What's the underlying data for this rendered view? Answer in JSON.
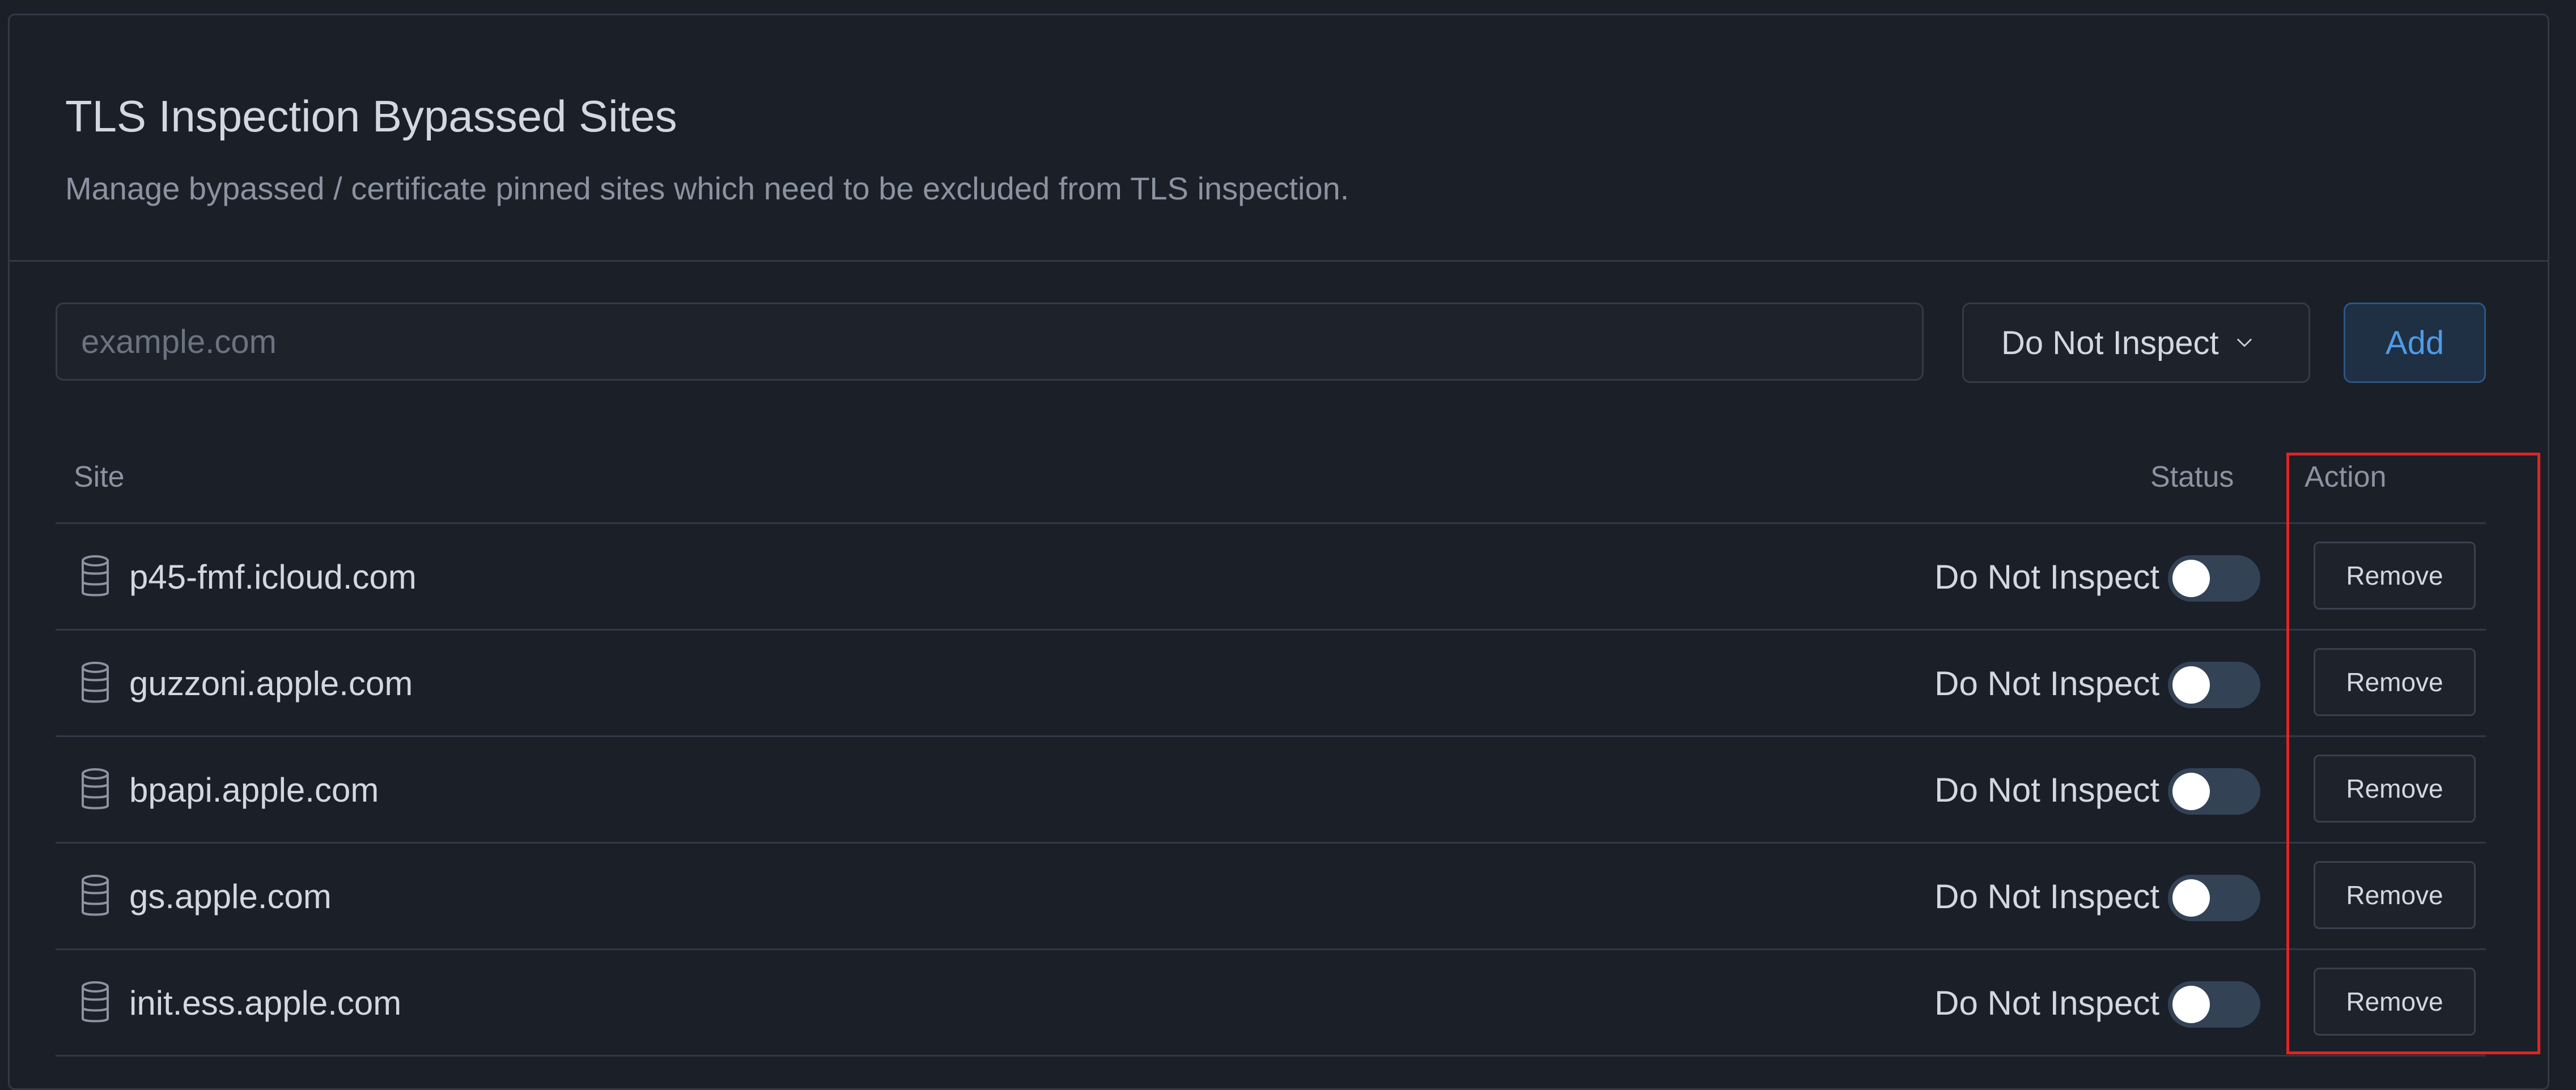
{
  "header": {
    "title": "TLS Inspection Bypassed Sites",
    "subtitle": "Manage bypassed / certificate pinned sites which need to be excluded from TLS inspection."
  },
  "form": {
    "site_placeholder": "example.com",
    "mode_value": "Do Not Inspect",
    "add_label": "Add"
  },
  "table": {
    "columns": [
      "Site",
      "Status",
      "Action"
    ],
    "rows": [
      {
        "site": "p45-fmf.icloud.com",
        "status": "Do Not Inspect",
        "enabled": false,
        "action": "Remove"
      },
      {
        "site": "guzzoni.apple.com",
        "status": "Do Not Inspect",
        "enabled": false,
        "action": "Remove"
      },
      {
        "site": "bpapi.apple.com",
        "status": "Do Not Inspect",
        "enabled": false,
        "action": "Remove"
      },
      {
        "site": "gs.apple.com",
        "status": "Do Not Inspect",
        "enabled": false,
        "action": "Remove"
      },
      {
        "site": "init.ess.apple.com",
        "status": "Do Not Inspect",
        "enabled": false,
        "action": "Remove"
      }
    ]
  },
  "icons": {
    "row_icon": "database-icon",
    "select_icon": "chevron-down-icon"
  },
  "colors": {
    "background": "#1b1f28",
    "accent": "#4d9be6",
    "highlight": "#e02424",
    "toggle_off": "#344256"
  }
}
